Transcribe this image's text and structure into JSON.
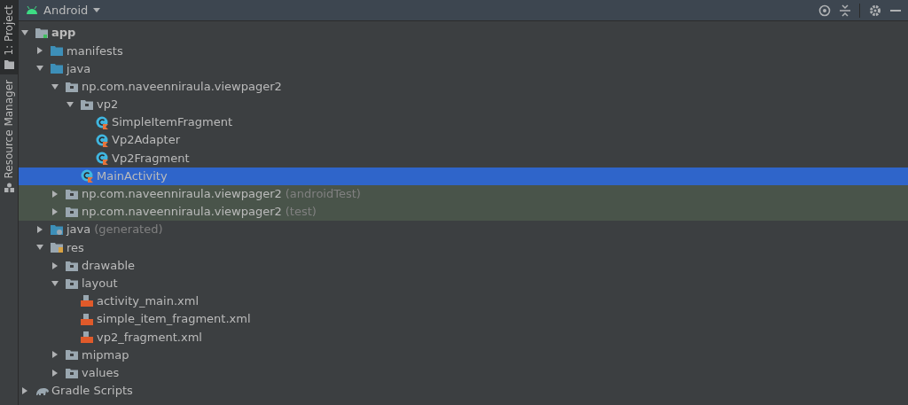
{
  "side_tabs": [
    {
      "label": "1: Project",
      "kind": "folder",
      "selected": true
    },
    {
      "label": "Resource Manager",
      "kind": "resources",
      "selected": false
    }
  ],
  "view_selector": {
    "label": "Android"
  },
  "tree": [
    {
      "label": "app",
      "kind": "module",
      "bold": true,
      "expanded": true,
      "selected": false,
      "test_source": false,
      "children": [
        {
          "label": "manifests",
          "kind": "source-folder",
          "bold": false,
          "expanded": false,
          "selected": false,
          "test_source": false
        },
        {
          "label": "java",
          "kind": "source-folder",
          "bold": false,
          "expanded": true,
          "selected": false,
          "test_source": false,
          "children": [
            {
              "label": "np.com.naveenniraula.viewpager2",
              "kind": "package",
              "bold": false,
              "expanded": true,
              "selected": false,
              "test_source": false,
              "children": [
                {
                  "label": "vp2",
                  "kind": "package",
                  "bold": false,
                  "expanded": true,
                  "selected": false,
                  "test_source": false,
                  "children": [
                    {
                      "label": "SimpleItemFragment",
                      "kind": "class",
                      "bold": false,
                      "selected": false,
                      "test_source": false
                    },
                    {
                      "label": "Vp2Adapter",
                      "kind": "class",
                      "bold": false,
                      "selected": false,
                      "test_source": false
                    },
                    {
                      "label": "Vp2Fragment",
                      "kind": "class",
                      "bold": false,
                      "selected": false,
                      "test_source": false
                    }
                  ]
                },
                {
                  "label": "MainActivity",
                  "kind": "class",
                  "bold": false,
                  "selected": true,
                  "test_source": false
                }
              ]
            },
            {
              "label": "np.com.naveenniraula.viewpager2",
              "suffix": "(androidTest)",
              "kind": "package",
              "bold": false,
              "expanded": false,
              "selected": false,
              "test_source": true
            },
            {
              "label": "np.com.naveenniraula.viewpager2",
              "suffix": "(test)",
              "kind": "package",
              "bold": false,
              "expanded": false,
              "selected": false,
              "test_source": true
            }
          ]
        },
        {
          "label": "java",
          "suffix": "(generated)",
          "kind": "generated-folder",
          "bold": false,
          "expanded": false,
          "selected": false,
          "test_source": false
        },
        {
          "label": "res",
          "kind": "res-folder",
          "bold": false,
          "expanded": true,
          "selected": false,
          "test_source": false,
          "children": [
            {
              "label": "drawable",
              "kind": "package",
              "bold": false,
              "expanded": false,
              "selected": false,
              "test_source": false
            },
            {
              "label": "layout",
              "kind": "package",
              "bold": false,
              "expanded": true,
              "selected": false,
              "test_source": false,
              "children": [
                {
                  "label": "activity_main.xml",
                  "kind": "layout",
                  "bold": false,
                  "selected": false,
                  "test_source": false
                },
                {
                  "label": "simple_item_fragment.xml",
                  "kind": "layout",
                  "bold": false,
                  "selected": false,
                  "test_source": false
                },
                {
                  "label": "vp2_fragment.xml",
                  "kind": "layout",
                  "bold": false,
                  "selected": false,
                  "test_source": false
                }
              ]
            },
            {
              "label": "mipmap",
              "kind": "package",
              "bold": false,
              "expanded": false,
              "selected": false,
              "test_source": false
            },
            {
              "label": "values",
              "kind": "package",
              "bold": false,
              "expanded": false,
              "selected": false,
              "test_source": false
            }
          ]
        }
      ]
    },
    {
      "label": "Gradle Scripts",
      "kind": "gradle",
      "bold": false,
      "expanded": false,
      "selected": false,
      "test_source": false
    }
  ]
}
